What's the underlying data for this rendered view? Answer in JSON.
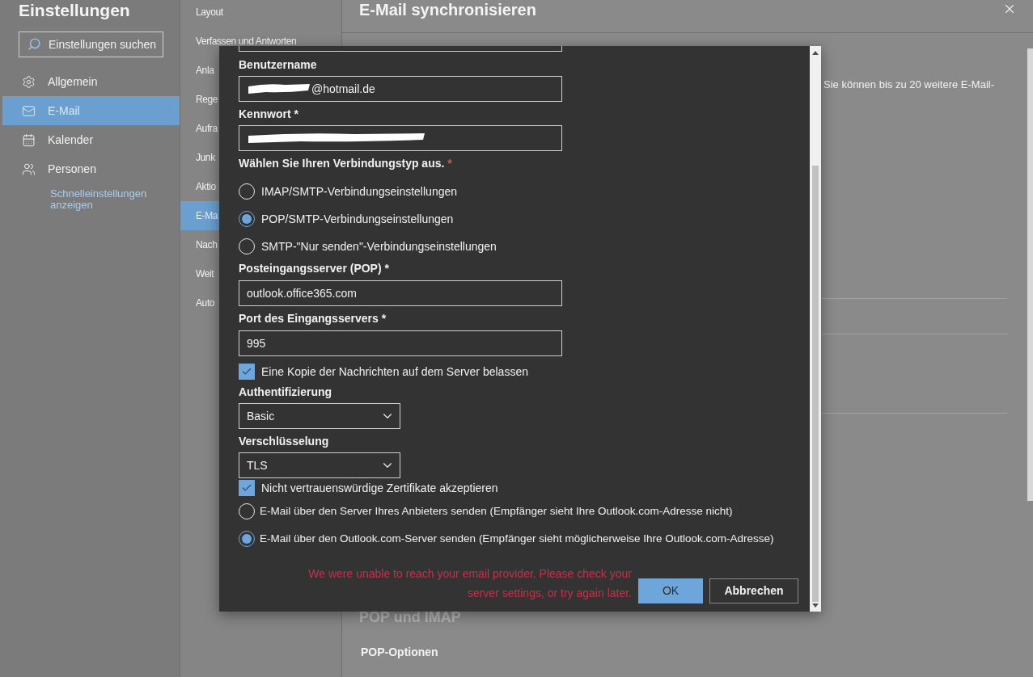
{
  "settings": {
    "title": "Einstellungen",
    "search": {
      "placeholder": "Einstellungen suchen"
    },
    "nav": [
      {
        "label": "Allgemein",
        "selected": false
      },
      {
        "label": "E-Mail",
        "selected": true
      },
      {
        "label": "Kalender",
        "selected": false
      },
      {
        "label": "Personen",
        "selected": false
      }
    ],
    "quick_link": "Schnelleinstellungen anzeigen"
  },
  "subnav": [
    {
      "label": "Layout",
      "selected": false
    },
    {
      "label": "Verfassen und Antworten",
      "selected": false
    },
    {
      "label": "Anla",
      "selected": false
    },
    {
      "label": "Rege",
      "selected": false
    },
    {
      "label": "Aufra",
      "selected": false
    },
    {
      "label": "Junk",
      "selected": false
    },
    {
      "label": "Aktio",
      "selected": false
    },
    {
      "label": "E-Ma",
      "selected": true
    },
    {
      "label": "Nach",
      "selected": false
    },
    {
      "label": "Weit",
      "selected": false
    },
    {
      "label": "Auto",
      "selected": false
    }
  ],
  "panel": {
    "title": "E-Mail synchronisieren",
    "intro": "Sie können bis zu 20 weitere E-Mail-",
    "section_title": "POP und IMAP",
    "subsection_title": "POP-Optionen"
  },
  "dialog": {
    "username": {
      "label": "Benutzername",
      "value": "@hotmail.de",
      "redacted": true
    },
    "password": {
      "label": "Kennwort *",
      "redacted": true
    },
    "connection_type": {
      "label": "Wählen Sie Ihren Verbindungstyp aus.",
      "required_mark": "*",
      "options": [
        {
          "label": "IMAP/SMTP-Verbindungseinstellungen",
          "selected": false
        },
        {
          "label": "POP/SMTP-Verbindungseinstellungen",
          "selected": true
        },
        {
          "label": "SMTP-\"Nur senden\"-Verbindungseinstellungen",
          "selected": false
        }
      ]
    },
    "incoming_server": {
      "label": "Posteingangsserver (POP) *",
      "value": "outlook.office365.com"
    },
    "port": {
      "label": "Port des Eingangsservers *",
      "value": "995"
    },
    "keep_copy": {
      "label": "Eine Kopie der Nachrichten auf dem Server belassen",
      "checked": true
    },
    "authentication": {
      "label": "Authentifizierung",
      "value": "Basic"
    },
    "encryption": {
      "label": "Verschlüsselung",
      "value": "TLS"
    },
    "accept_untrusted": {
      "label": "Nicht vertrauenswürdige Zertifikate akzeptieren",
      "checked": true
    },
    "send_via": [
      {
        "label": "E-Mail über den Server Ihres Anbieters senden (Empfänger sieht Ihre Outlook.com-Adresse nicht)",
        "selected": false
      },
      {
        "label": "E-Mail über den Outlook.com-Server senden (Empfänger sieht möglicherweise Ihre Outlook.com-Adresse)",
        "selected": true
      }
    ],
    "error": "We were unable to reach your email provider. Please check your server settings, or try again later.",
    "buttons": [
      {
        "label": "OK",
        "kind": "primary"
      },
      {
        "label": "Abbrechen",
        "kind": "secondary"
      }
    ]
  }
}
